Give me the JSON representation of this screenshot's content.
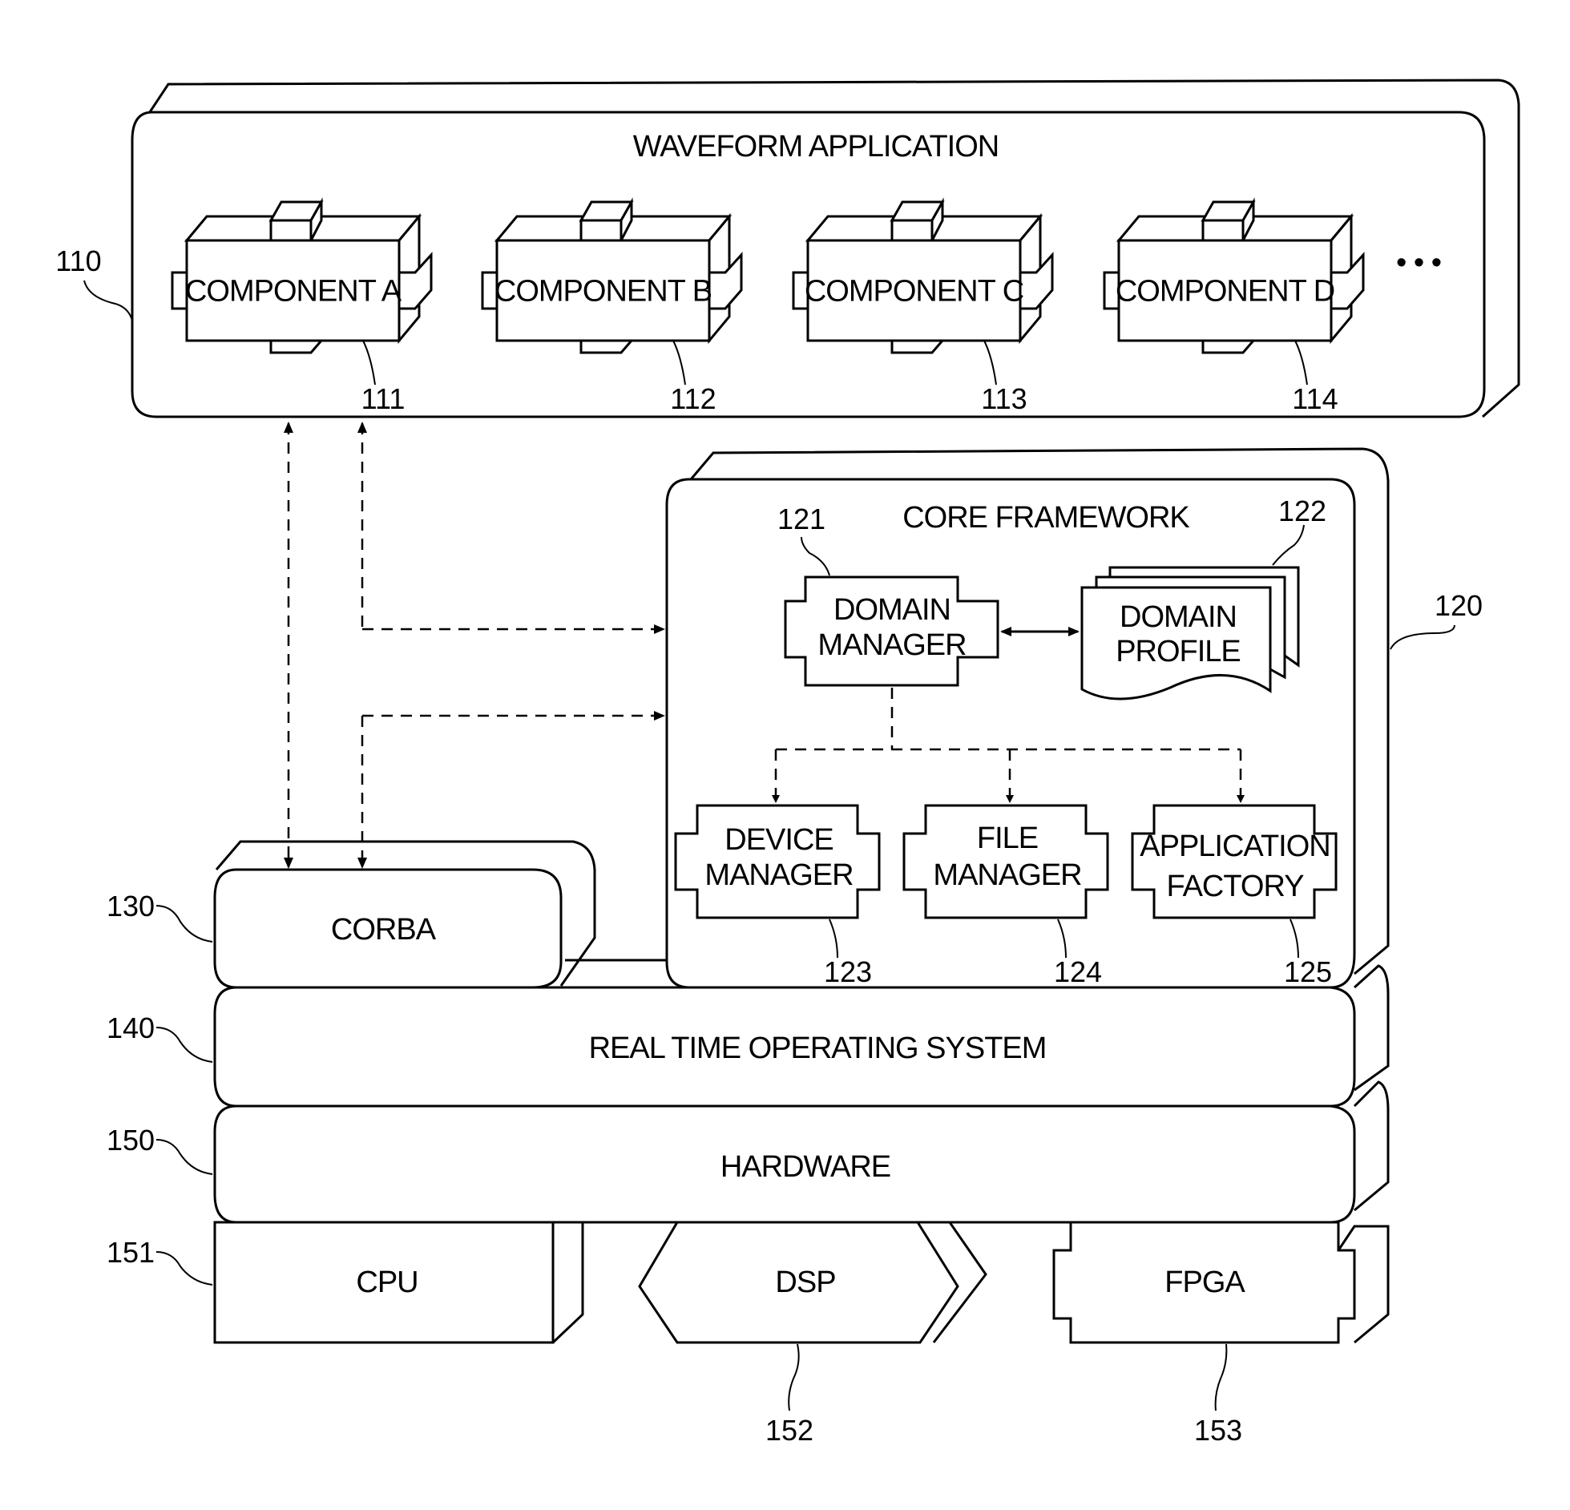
{
  "waveform": {
    "title": "WAVEFORM APPLICATION",
    "ref": "110",
    "ellipsis": "• • •",
    "components": [
      {
        "label": "COMPONENT A",
        "ref": "111"
      },
      {
        "label": "COMPONENT B",
        "ref": "112"
      },
      {
        "label": "COMPONENT C",
        "ref": "113"
      },
      {
        "label": "COMPONENT D",
        "ref": "114"
      }
    ]
  },
  "core": {
    "title": "CORE FRAMEWORK",
    "ref": "120",
    "domain_manager": {
      "line1": "DOMAIN",
      "line2": "MANAGER",
      "ref": "121"
    },
    "domain_profile": {
      "line1": "DOMAIN",
      "line2": "PROFILE",
      "ref": "122"
    },
    "device_manager": {
      "line1": "DEVICE",
      "line2": "MANAGER",
      "ref": "123"
    },
    "file_manager": {
      "line1": "FILE",
      "line2": "MANAGER",
      "ref": "124"
    },
    "app_factory": {
      "line1": "APPLICATION",
      "line2": "FACTORY",
      "ref": "125"
    }
  },
  "corba": {
    "label": "CORBA",
    "ref": "130"
  },
  "rtos": {
    "label": "REAL TIME OPERATING SYSTEM",
    "ref": "140"
  },
  "hardware": {
    "label": "HARDWARE",
    "ref": "150",
    "cpu": {
      "label": "CPU",
      "ref": "151"
    },
    "dsp": {
      "label": "DSP",
      "ref": "152"
    },
    "fpga": {
      "label": "FPGA",
      "ref": "153"
    }
  }
}
